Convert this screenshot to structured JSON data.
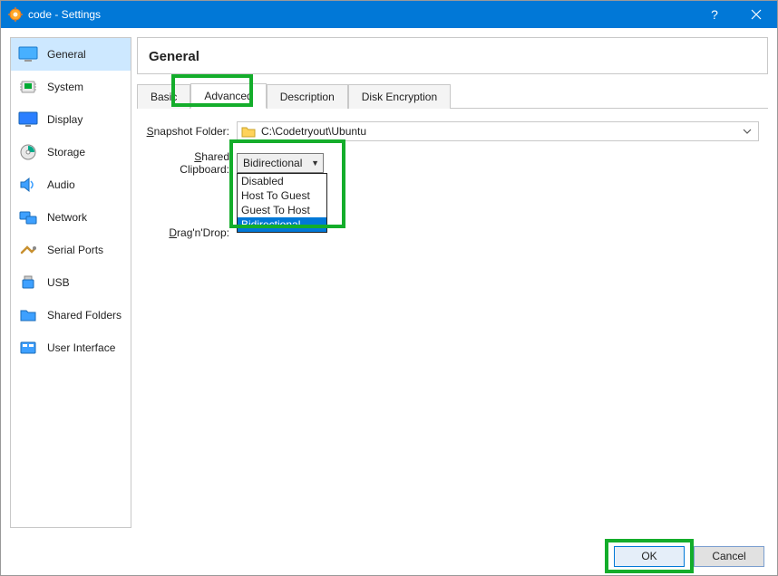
{
  "window": {
    "title": "code - Settings"
  },
  "sidebar": {
    "items": [
      {
        "label": "General"
      },
      {
        "label": "System"
      },
      {
        "label": "Display"
      },
      {
        "label": "Storage"
      },
      {
        "label": "Audio"
      },
      {
        "label": "Network"
      },
      {
        "label": "Serial Ports"
      },
      {
        "label": "USB"
      },
      {
        "label": "Shared Folders"
      },
      {
        "label": "User Interface"
      }
    ],
    "selected_index": 0
  },
  "page": {
    "title": "General",
    "tabs": [
      {
        "label": "Basic"
      },
      {
        "label": "Advanced"
      },
      {
        "label": "Description"
      },
      {
        "label": "Disk Encryption"
      }
    ],
    "active_tab_index": 1
  },
  "form": {
    "snapshot_label_prefix": "S",
    "snapshot_label_rest": "napshot Folder:",
    "snapshot_path": "C:\\Codetryout\\Ubuntu",
    "clipboard_label_prefix": "S",
    "clipboard_label_rest": "hared Clipboard:",
    "clipboard_selected": "Bidirectional",
    "clipboard_options": [
      "Disabled",
      "Host To Guest",
      "Guest To Host",
      "Bidirectional"
    ],
    "dragdrop_label_prefix": "D",
    "dragdrop_label_rest": "rag'n'Drop:"
  },
  "footer": {
    "ok": "OK",
    "cancel": "Cancel"
  }
}
